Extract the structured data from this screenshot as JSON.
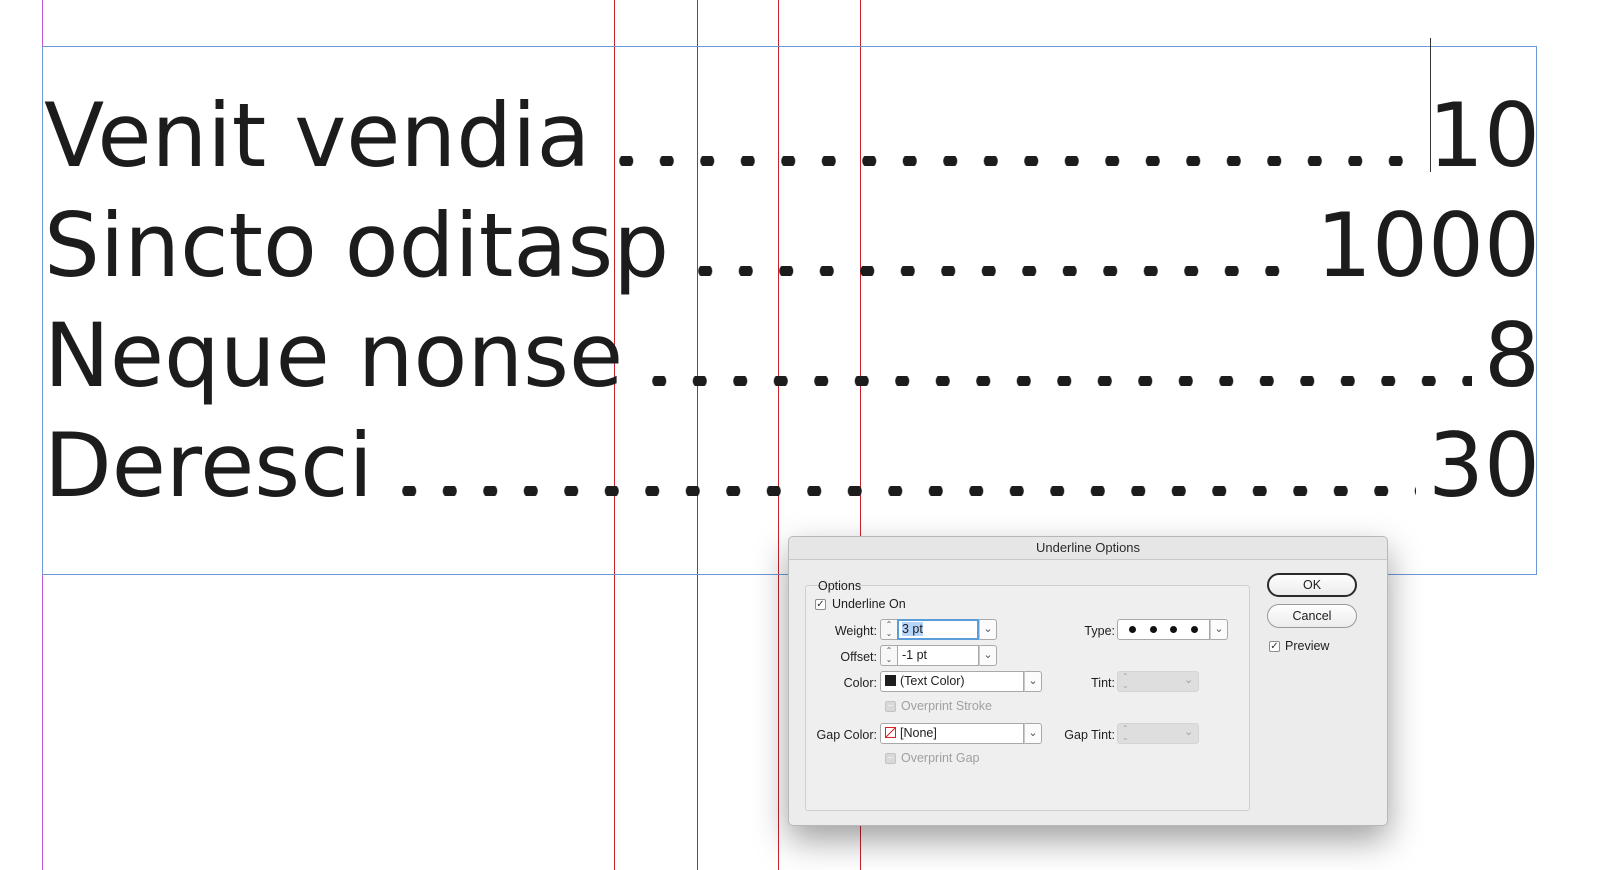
{
  "document": {
    "toc_entries": [
      {
        "title": "Venit vendia",
        "page": "10"
      },
      {
        "title": "Sincto oditasp",
        "page": "1000"
      },
      {
        "title": "Neque nonse",
        "page": "8"
      },
      {
        "title": "Deresci",
        "page": "30"
      }
    ]
  },
  "dialog": {
    "title": "Underline Options",
    "group_title": "Options",
    "underline_on": {
      "label": "Underline On",
      "checked": true
    },
    "weight": {
      "label": "Weight:",
      "value": "3 pt"
    },
    "offset": {
      "label": "Offset:",
      "value": "-1 pt"
    },
    "color": {
      "label": "Color:",
      "value": "(Text Color)"
    },
    "overprint_stroke": {
      "label": "Overprint Stroke",
      "checked": false
    },
    "gap_color": {
      "label": "Gap Color:",
      "value": "[None]"
    },
    "overprint_gap": {
      "label": "Overprint Gap",
      "checked": false
    },
    "type": {
      "label": "Type:"
    },
    "tint": {
      "label": "Tint:"
    },
    "gap_tint": {
      "label": "Gap Tint:"
    },
    "ok_label": "OK",
    "cancel_label": "Cancel",
    "preview": {
      "label": "Preview",
      "checked": true
    }
  },
  "colors": {
    "margin_guide": "#c25ad6",
    "column_guide": "#c8232c",
    "frame_edge": "#6d97d6",
    "focus_ring": "#5b9dd9"
  }
}
